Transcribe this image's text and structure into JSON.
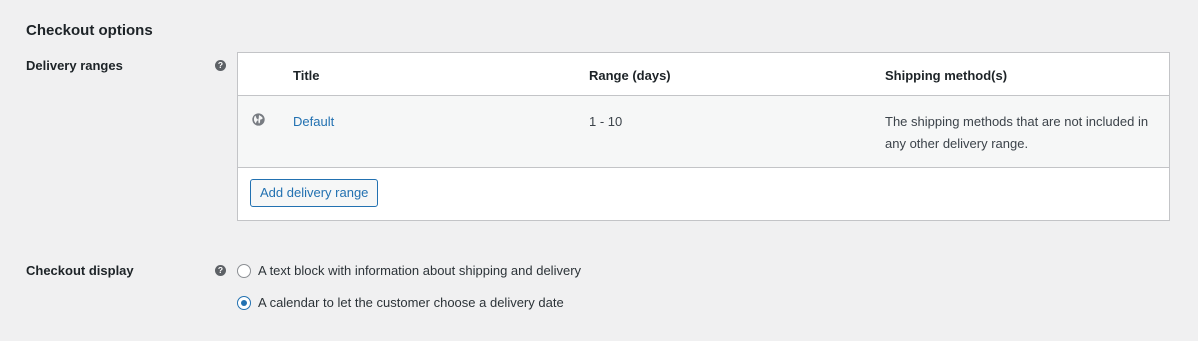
{
  "section": {
    "title": "Checkout options"
  },
  "delivery_ranges": {
    "label": "Delivery ranges",
    "help_icon": "question-circle-icon",
    "columns": [
      "Title",
      "Range (days)",
      "Shipping method(s)"
    ],
    "rows": [
      {
        "icon": "globe-icon",
        "title": "Default",
        "range": "1 - 10",
        "methods": "The shipping methods that are not included in any other delivery range."
      }
    ],
    "add_button": "Add delivery range"
  },
  "checkout_display": {
    "label": "Checkout display",
    "help_icon": "question-circle-icon",
    "options": [
      {
        "label": "A text block with information about shipping and delivery",
        "checked": false
      },
      {
        "label": "A calendar to let the customer choose a delivery date",
        "checked": true
      }
    ]
  },
  "colors": {
    "accent": "#2271b1",
    "background": "#f0f0f1"
  }
}
